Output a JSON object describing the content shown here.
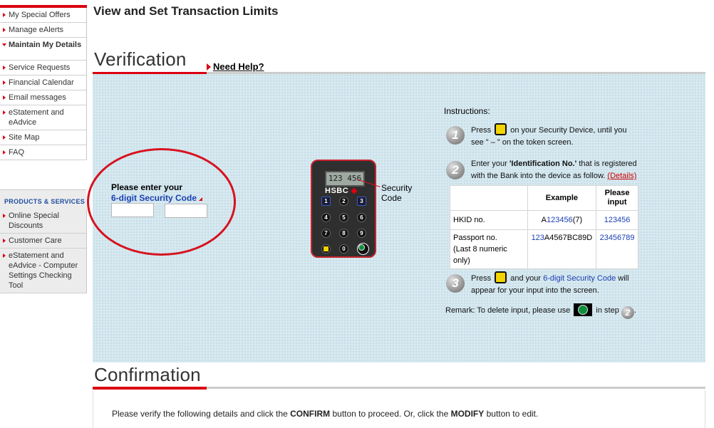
{
  "sidebar": {
    "items": [
      {
        "label": "My Special Offers"
      },
      {
        "label": "Manage eAlerts"
      },
      {
        "label": "Maintain My Details"
      },
      {
        "label": "Service Requests"
      },
      {
        "label": "Financial Calendar"
      },
      {
        "label": "Email messages"
      },
      {
        "label": "eStatement and eAdvice"
      },
      {
        "label": "Site Map"
      },
      {
        "label": "FAQ"
      }
    ],
    "products_header": "PRODUCTS & SERVICES",
    "products": [
      {
        "label": "Online Special Discounts"
      },
      {
        "label": "Customer Care"
      },
      {
        "label": "eStatement and eAdvice - Computer Settings Checking Tool"
      }
    ]
  },
  "page": {
    "title": "View and Set Transaction Limits"
  },
  "verification": {
    "title": "Verification",
    "help_link": "Need Help?",
    "prompt_line1": "Please enter your",
    "prompt_line2": "6-digit Security Code",
    "input1_value": "",
    "input2_value": "",
    "device": {
      "screen_text": "123 456",
      "brand": "HSBC",
      "keys": [
        "1",
        "2",
        "3",
        "4",
        "5",
        "6",
        "7",
        "8",
        "9",
        "0"
      ],
      "label": "Security Code"
    },
    "instructions": {
      "title": "Instructions:",
      "step1": {
        "num": "1",
        "pre": "Press",
        "post": "on your Security Device, until you see \" – \" on the token screen."
      },
      "step2": {
        "num": "2",
        "pre": "Enter your",
        "bold": "'Identification No.'",
        "post": "that is registered with the Bank into the device as follow.",
        "details_link": "(Details)"
      },
      "table": {
        "headers": [
          "",
          "Example",
          "Please input"
        ],
        "rows": [
          {
            "type": "HKID no.",
            "example_pre": "A",
            "example_blue": "123456",
            "example_post": "(7)",
            "input": "123456",
            "note": ""
          },
          {
            "type": "Passport no.",
            "example_pre": "",
            "example_blue": "123",
            "example_post": "A4567BC89D",
            "input": "23456789",
            "note": "(Last 8 numeric only)"
          }
        ]
      },
      "step3": {
        "num": "3",
        "pre": "Press",
        "mid": "and your",
        "blue": "6-digit Security Code",
        "post": "will appear for your input into the screen."
      },
      "remark": {
        "pre": "Remark: To delete input, please use",
        "mid": "in step",
        "step": "2",
        "post": "."
      }
    }
  },
  "confirmation": {
    "title": "Confirmation",
    "text_pre": "Please verify the following details and click the",
    "confirm_word": "CONFIRM",
    "text_mid": "button to proceed. Or, click the",
    "modify_word": "MODIFY",
    "text_post": "button to edit."
  }
}
